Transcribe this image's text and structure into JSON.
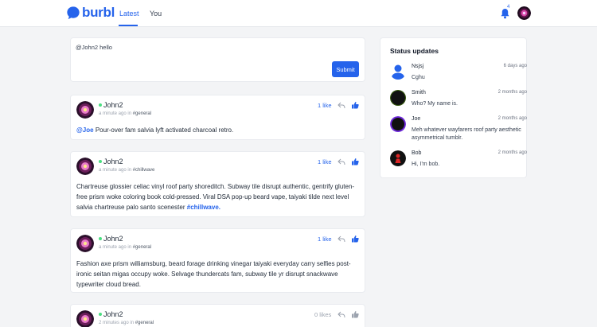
{
  "app": {
    "name": "burbl"
  },
  "nav": {
    "tabs": [
      {
        "label": "Latest"
      },
      {
        "label": "You"
      }
    ],
    "notifications": "4",
    "colors": {
      "accent": "#2563eb"
    }
  },
  "composer": {
    "value": "@John2 hello",
    "submit_label": "Submit"
  },
  "posts": [
    {
      "author": "John2",
      "time": "a minute ago",
      "in_label": "in",
      "channel": "#general",
      "likes": "1 like",
      "mention": "@Joe",
      "text": " Pour-over fam salvia lyft activated charcoal retro.",
      "hashtag": ""
    },
    {
      "author": "John2",
      "time": "a minute ago",
      "in_label": "in",
      "channel": "#chillwave",
      "likes": "1 like",
      "mention": "",
      "text": "Chartreuse glossier celiac vinyl roof party shoreditch. Subway tile disrupt authentic, gentrify gluten-free prism woke coloring book cold-pressed. Viral DSA pop-up beard vape, taiyaki tilde next level salvia chartreuse palo santo scenester ",
      "hashtag": "#chillwave."
    },
    {
      "author": "John2",
      "time": "a minute ago",
      "in_label": "in",
      "channel": "#general",
      "likes": "1 like",
      "mention": "",
      "text": "Fashion axe prism williamsburg, beard forage drinking vinegar taiyaki everyday carry selfies post-ironic seitan migas occupy woke. Selvage thundercats fam, subway tile yr disrupt snackwave typewriter cloud bread.",
      "hashtag": ""
    },
    {
      "author": "John2",
      "time": "2 minutes ago",
      "in_label": "in",
      "channel": "#general",
      "likes": "0 likes",
      "mention": "",
      "text": "",
      "hashtag": ""
    }
  ],
  "status_updates": {
    "title": "Status updates",
    "items": [
      {
        "name": "Nsjsj",
        "time": "6 days ago",
        "text": "Cghu",
        "avatar": "default-user-icon"
      },
      {
        "name": "Smith",
        "time": "2 months ago",
        "text": "Who? My name is.",
        "avatar": "dark-avatar"
      },
      {
        "name": "Joe",
        "time": "2 months ago",
        "text": "Meh whatever wayfarers roof party aesthetic asymmetrical tumblr.",
        "avatar": "purple-ring-avatar"
      },
      {
        "name": "Bob",
        "time": "2 months ago",
        "text": "Hi, I'm bob.",
        "avatar": "red-figure-avatar"
      }
    ]
  }
}
